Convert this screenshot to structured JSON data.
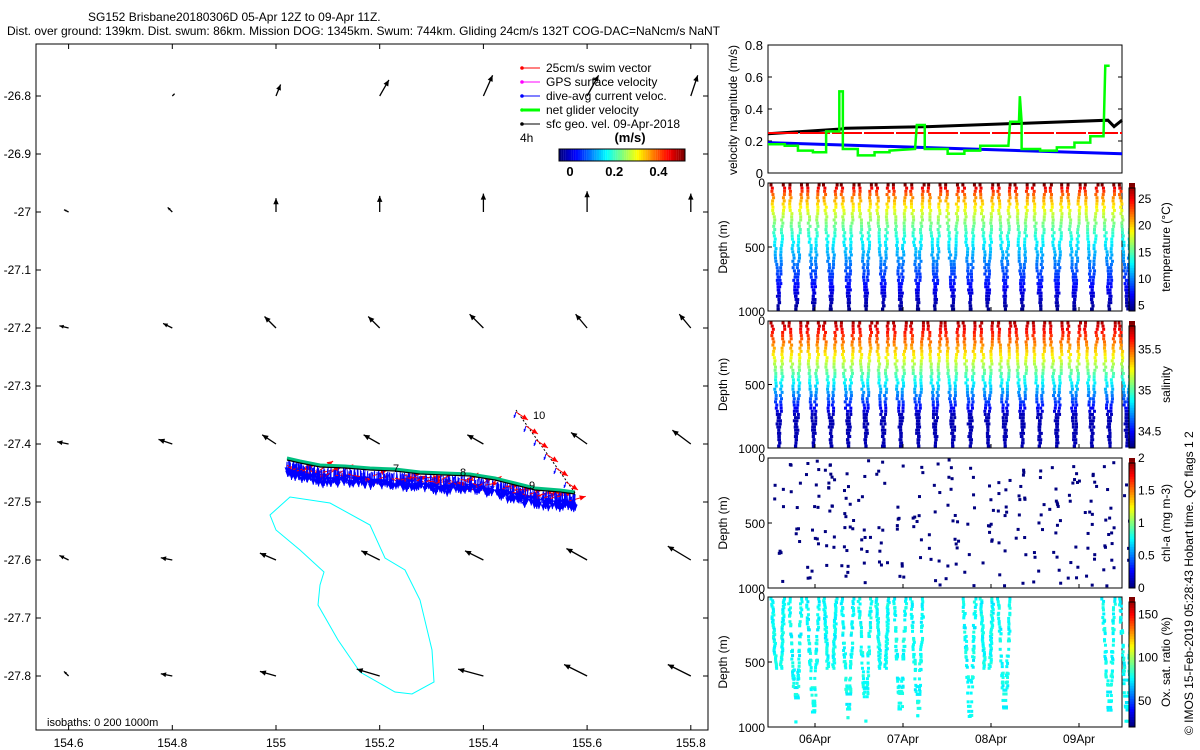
{
  "title": {
    "line1": "SG152 Brisbane20180306D 05-Apr 12Z to 09-Apr 11Z.",
    "line2": "Dist. over ground: 139km. Dist. swum: 86km. Mission DOG: 1345km. Swum: 744km. Gliding 24cm/s 132T COG-DAC=NaNcm/s NaNT"
  },
  "footer": "© IMOS 15-Feb-2019 05:28:43 Hobart time. QC flags 1  2",
  "chart_data": [
    {
      "type": "map",
      "xticks": [
        "154.6",
        "154.8",
        "155",
        "155.2",
        "155.4",
        "155.6",
        "155.8"
      ],
      "yticks": [
        "-26.8",
        "-26.9",
        "-27",
        "-27.1",
        "-27.2",
        "-27.3",
        "-27.4",
        "-27.5",
        "-27.6",
        "-27.7",
        "-27.8"
      ],
      "xlim": [
        154.54,
        155.86
      ],
      "ylim": [
        -27.89,
        -26.72
      ],
      "legend": {
        "placement": "top-right",
        "items": [
          {
            "label": "25cm/s swim vector",
            "color": "#ff0000"
          },
          {
            "label": "GPS surface velocity",
            "color": "#ff00ff"
          },
          {
            "label": "dive-avg current veloc.",
            "color": "#0000ff"
          },
          {
            "label": "net glider velocity",
            "color": "#00ff00"
          },
          {
            "label": "sfc geo. vel. 09-Apr-2018",
            "color": "#000000"
          }
        ],
        "time_label": "4h",
        "colorbar_unit": "(m/s)",
        "colorbar_ticks": [
          "0",
          "0.2",
          "0.4"
        ],
        "colorbar_range": [
          -0.05,
          0.52
        ]
      },
      "isobaths_label": "isobaths: 0   200  1000m",
      "track_labels": [
        "7",
        "8",
        "9",
        "10"
      ],
      "sfc_vectors": {
        "lons": [
          154.6,
          154.8,
          155.0,
          155.2,
          155.4,
          155.6,
          155.8
        ],
        "lats": [
          -26.8,
          -27.0,
          -27.2,
          -27.4,
          -27.6,
          -27.8
        ],
        "u": [
          [
            0.0,
            0.01,
            0.02,
            0.04,
            0.04,
            0.05,
            0.03
          ],
          [
            -0.02,
            -0.02,
            0.0,
            0.0,
            0.0,
            0.0,
            0.0
          ],
          [
            -0.04,
            -0.04,
            -0.05,
            -0.05,
            -0.06,
            -0.05,
            -0.05
          ],
          [
            -0.05,
            -0.06,
            -0.06,
            -0.07,
            -0.07,
            -0.07,
            -0.08
          ],
          [
            -0.04,
            -0.05,
            -0.07,
            -0.08,
            -0.08,
            -0.09,
            -0.1
          ],
          [
            -0.02,
            -0.05,
            -0.07,
            -0.1,
            -0.11,
            -0.1,
            -0.1
          ]
        ],
        "v": [
          [
            0.0,
            0.01,
            0.05,
            0.07,
            0.09,
            0.09,
            0.09
          ],
          [
            0.01,
            0.02,
            0.06,
            0.07,
            0.08,
            0.09,
            0.08
          ],
          [
            0.01,
            0.02,
            0.05,
            0.05,
            0.06,
            0.06,
            0.06
          ],
          [
            0.01,
            0.02,
            0.04,
            0.04,
            0.04,
            0.05,
            0.06
          ],
          [
            0.02,
            0.01,
            0.03,
            0.04,
            0.04,
            0.05,
            0.06
          ],
          [
            0.02,
            0.01,
            0.02,
            0.03,
            0.03,
            0.05,
            0.05
          ]
        ]
      }
    },
    {
      "type": "line",
      "ylabel": "velocity magnitude (m/s)",
      "ylim": [
        0,
        0.8
      ],
      "yticks": [
        "0",
        "0.2",
        "0.4",
        "0.6",
        "0.8"
      ],
      "xlim": [
        5.47,
        9.49
      ],
      "series": [
        {
          "color": "#000000",
          "x": [
            5.47,
            6.3,
            6.35,
            7.3,
            8.3,
            8.35,
            9.33,
            9.4,
            9.49
          ],
          "y": [
            0.245,
            0.275,
            0.28,
            0.29,
            0.31,
            0.31,
            0.33,
            0.29,
            0.33
          ]
        },
        {
          "color": "#ff0000",
          "x": [
            5.47,
            9.49
          ],
          "y": [
            0.25,
            0.25
          ]
        },
        {
          "color": "#0000ff",
          "x": [
            5.47,
            9.49
          ],
          "y": [
            0.19,
            0.12
          ]
        },
        {
          "color": "#00ff00",
          "x": [
            5.47,
            5.66,
            5.66,
            5.81,
            5.81,
            5.98,
            5.98,
            6.13,
            6.13,
            6.28,
            6.28,
            6.32,
            6.32,
            6.49,
            6.49,
            6.68,
            6.68,
            6.85,
            6.85,
            7.14,
            7.16,
            7.25,
            7.25,
            7.51,
            7.51,
            7.7,
            7.7,
            7.88,
            7.88,
            8.2,
            8.22,
            8.32,
            8.33,
            8.35,
            8.35,
            8.56,
            8.56,
            8.75,
            8.75,
            8.95,
            8.95,
            9.13,
            9.13,
            9.28,
            9.3,
            9.35
          ],
          "y": [
            0.18,
            0.18,
            0.17,
            0.17,
            0.14,
            0.14,
            0.13,
            0.13,
            0.26,
            0.26,
            0.51,
            0.51,
            0.15,
            0.15,
            0.11,
            0.11,
            0.13,
            0.13,
            0.14,
            0.15,
            0.3,
            0.3,
            0.15,
            0.15,
            0.12,
            0.12,
            0.14,
            0.14,
            0.17,
            0.17,
            0.32,
            0.32,
            0.48,
            0.32,
            0.15,
            0.15,
            0.14,
            0.14,
            0.16,
            0.16,
            0.19,
            0.19,
            0.23,
            0.23,
            0.67,
            0.67
          ]
        }
      ]
    },
    {
      "type": "scatter",
      "ylabel": "Depth (m)",
      "yticks": [
        "0",
        "500",
        "1000"
      ],
      "ylim": [
        1000,
        0
      ],
      "colorbar_label": "temperature (°C)",
      "colorbar_ticks": [
        "5",
        "10",
        "15",
        "20",
        "25"
      ],
      "clim": [
        4,
        28
      ]
    },
    {
      "type": "scatter",
      "ylabel": "Depth (m)",
      "yticks": [
        "0",
        "500",
        "1000"
      ],
      "ylim": [
        1000,
        0
      ],
      "colorbar_label": "salinity",
      "colorbar_ticks": [
        "34.5",
        "35",
        "35.5"
      ],
      "clim": [
        34.3,
        35.85
      ]
    },
    {
      "type": "scatter",
      "ylabel": "Depth (m)",
      "yticks": [
        "0",
        "500",
        "1000"
      ],
      "ylim": [
        1000,
        0
      ],
      "colorbar_label": "chl-a (mg m-3)",
      "colorbar_ticks": [
        "0",
        "0.5",
        "1",
        "1.5",
        "2"
      ],
      "clim": [
        0,
        2
      ]
    },
    {
      "type": "scatter",
      "ylabel": "Depth (m)",
      "yticks": [
        "0",
        "500",
        "1000"
      ],
      "ylim": [
        1000,
        0
      ],
      "colorbar_label": "Ox. sat. ratio (%)",
      "colorbar_ticks": [
        "50",
        "100",
        "150"
      ],
      "clim": [
        20,
        170
      ],
      "xticks": [
        "06Apr",
        "07Apr",
        "08Apr",
        "09Apr"
      ]
    }
  ]
}
